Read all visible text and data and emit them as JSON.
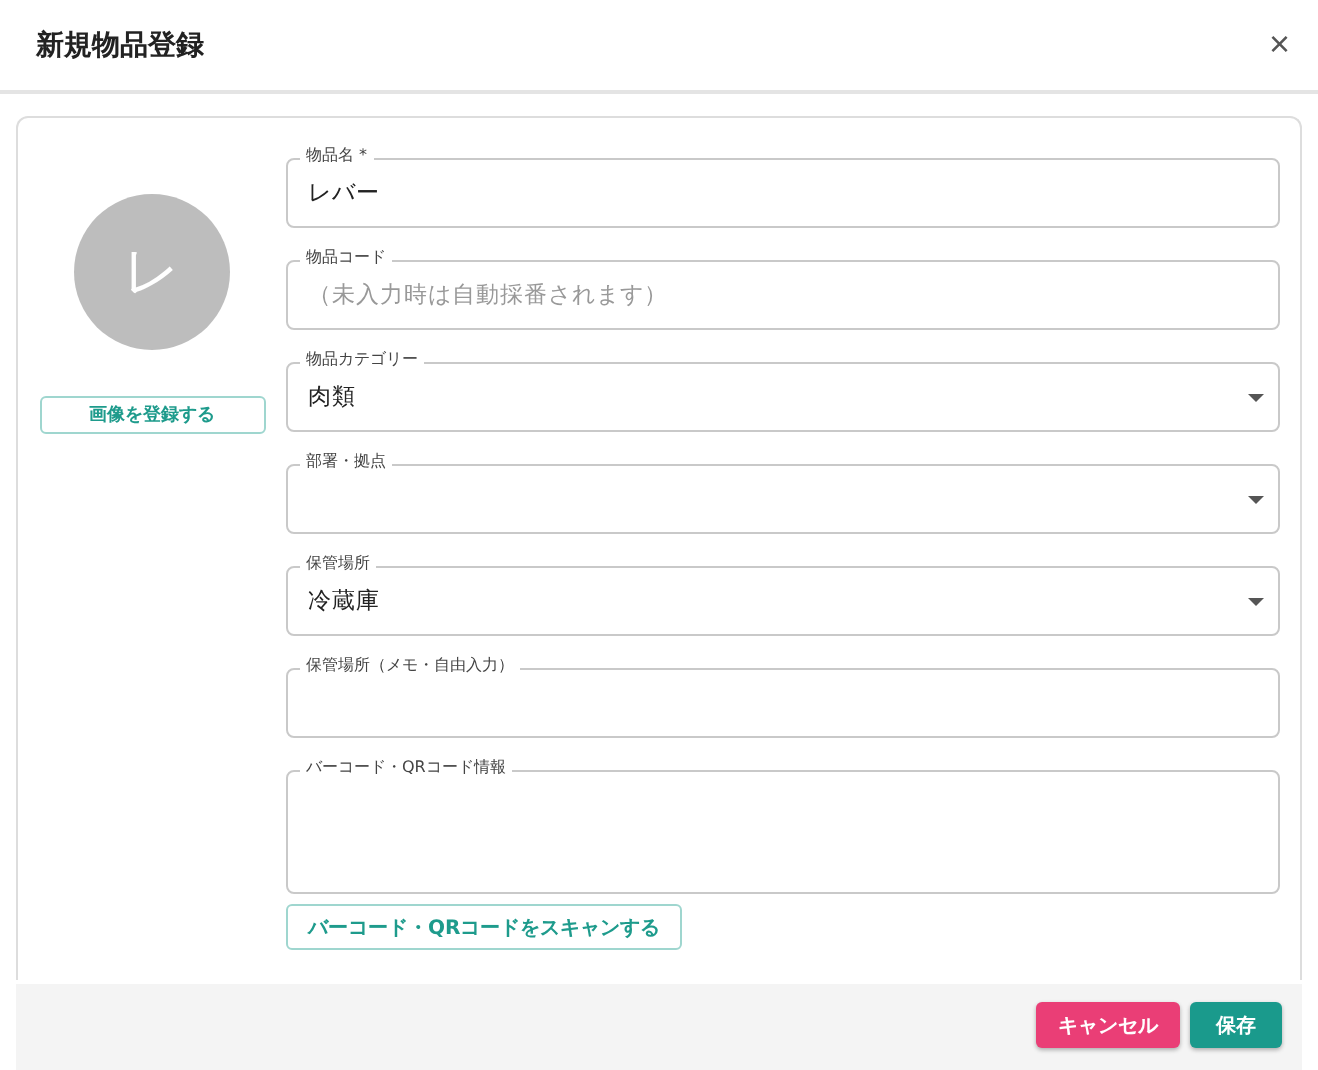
{
  "dialog": {
    "title": "新規物品登録",
    "close": "×"
  },
  "avatar": {
    "initial": "レ",
    "button": "画像を登録する"
  },
  "fields": [
    {
      "kind": "text",
      "label": "物品名 *",
      "value": "レバー"
    },
    {
      "kind": "text",
      "label": "物品コード",
      "placeholder": "（未入力時は自動採番されます）"
    },
    {
      "kind": "select",
      "label": "物品カテゴリー",
      "value": "肉類"
    },
    {
      "kind": "select",
      "label": "部署・拠点"
    },
    {
      "kind": "select",
      "label": "保管場所",
      "value": "冷蔵庫"
    },
    {
      "kind": "text",
      "label": "保管場所（メモ・自由入力）"
    },
    {
      "kind": "textarea",
      "label": "バーコード・QRコード情報"
    }
  ],
  "scan_button": "バーコード・QRコードをスキャンする",
  "footer": {
    "cancel": "キャンセル",
    "save": "保存"
  }
}
